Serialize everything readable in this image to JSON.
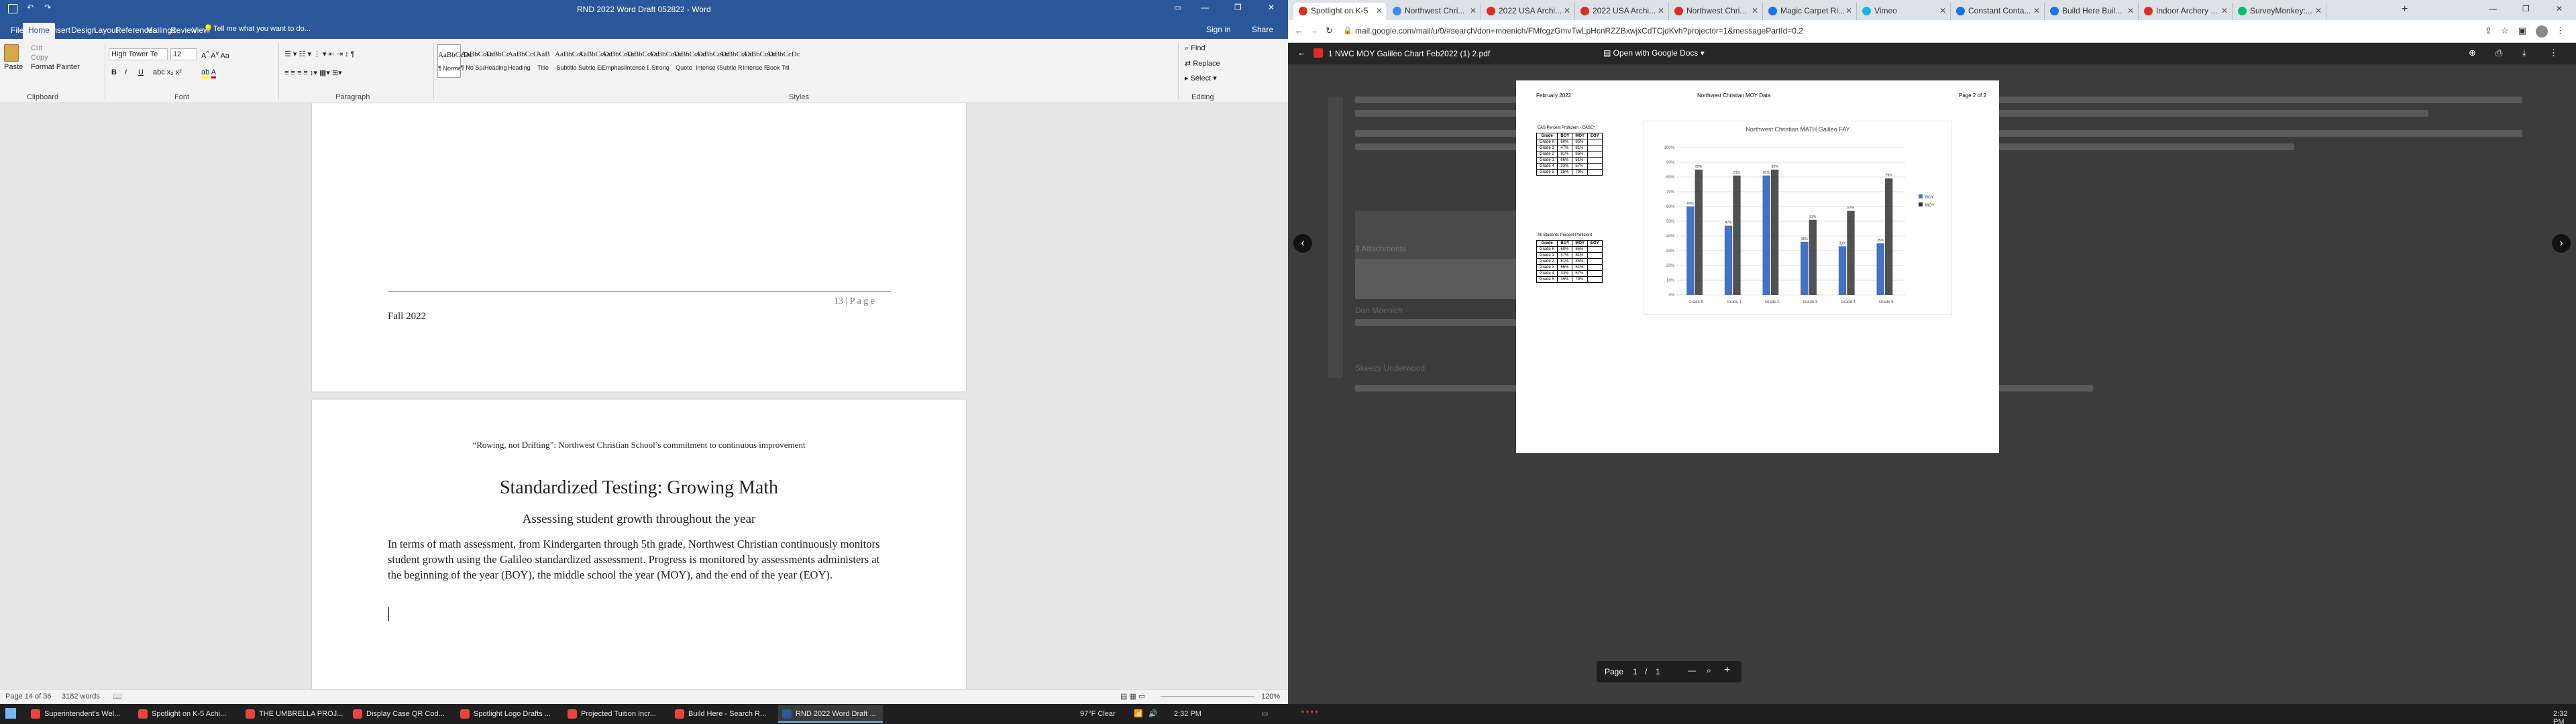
{
  "word": {
    "title": "RND 2022 Word Draft 052822  -  Word",
    "sign_in": "Sign in",
    "share": "Share",
    "tell_me": "Tell me what you want to do...",
    "tabs": [
      "File",
      "Home",
      "Insert",
      "Design",
      "Layout",
      "References",
      "Mailings",
      "Review",
      "View"
    ],
    "clipboard": {
      "paste": "Paste",
      "cut": "Cut",
      "copy": "Copy",
      "format_painter": "Format Painter",
      "label": "Clipboard"
    },
    "font": {
      "name": "High Tower Te",
      "size": "12",
      "label": "Font"
    },
    "paragraph_label": "Paragraph",
    "styles": [
      {
        "sample": "AaBbCcDc",
        "name": "¶ Normal"
      },
      {
        "sample": "AaBbCcDc",
        "name": "¶ No Spac..."
      },
      {
        "sample": "AaBbCc",
        "name": "Heading 1"
      },
      {
        "sample": "AaBbCcC",
        "name": "Heading 2"
      },
      {
        "sample": "AaB",
        "name": "Title"
      },
      {
        "sample": "AaBbCcC",
        "name": "Subtitle"
      },
      {
        "sample": "AaBbCcDc",
        "name": "Subtle Em..."
      },
      {
        "sample": "AaBbCcDc",
        "name": "Emphasis"
      },
      {
        "sample": "AaBbCcDc",
        "name": "Intense E..."
      },
      {
        "sample": "AaBbCcDc",
        "name": "Strong"
      },
      {
        "sample": "AaBbCcDc",
        "name": "Quote"
      },
      {
        "sample": "AaBbCcDc",
        "name": "Intense Q..."
      },
      {
        "sample": "AaBbCcDc",
        "name": "Subtle Ref..."
      },
      {
        "sample": "AaBbCcDc",
        "name": "Intense Re..."
      },
      {
        "sample": "AaBbCcDc",
        "name": "Book Title"
      }
    ],
    "styles_label": "Styles",
    "editing": {
      "find": "Find",
      "replace": "Replace",
      "select": "Select",
      "label": "Editing"
    },
    "doc": {
      "footer_left": "Fall 2022",
      "footer_right": "13 | P a g e",
      "header": "“Rowing, not Drifting”:  Northwest Christian School’s commitment to continuous improvement",
      "heading": "Standardized Testing:  Growing Math",
      "subheading": "Assessing student growth throughout the year",
      "paragraph": "In terms of math assessment, from Kindergarten through 5th grade, Northwest Christian continuously monitors student growth using the Galileo standardized assessment.  Progress is monitored by assessments administers at the beginning of the year (BOY), the middle school the year (MOY), and the end of the year (EOY)."
    },
    "status": {
      "page": "Page 14 of 36",
      "words": "3182 words",
      "zoom": "120%"
    }
  },
  "chrome": {
    "tabs": [
      {
        "label": "Spotlight on K-5",
        "color": "#d93025"
      },
      {
        "label": "Northwest Chri...",
        "color": "#4285f4"
      },
      {
        "label": "2022 USA Archi...",
        "color": "#d93025"
      },
      {
        "label": "2022 USA Archi...",
        "color": "#d93025"
      },
      {
        "label": "Northwest Chri...",
        "color": "#d93025"
      },
      {
        "label": "Magic Carpet Ri...",
        "color": "#1a73e8"
      },
      {
        "label": "Vimeo",
        "color": "#1ab7ea"
      },
      {
        "label": "Constant Conta...",
        "color": "#1a73e8"
      },
      {
        "label": "Build Here Buil...",
        "color": "#1a73e8"
      },
      {
        "label": "Indoor Archery ...",
        "color": "#d93025"
      },
      {
        "label": "SurveyMonkey:...",
        "color": "#00bf6f"
      }
    ],
    "url": "mail.google.com/mail/u/0/#search/don+moenich/FMfcgzGmvTwLpHcnRZZBxwjxCdTCjdKvh?projector=1&messagePartId=0.2",
    "viewer": {
      "filename": "1 NWC MOY Galileo Chart Feb2022 (1) 2.pdf",
      "open_with": "Open with Google Docs"
    },
    "pdf": {
      "date": "February 2022",
      "title": "Northwest Christian MOY Data",
      "page": "Page 2 of 2",
      "table1_title": "EAS Percent Proficient - CASE*",
      "table2_title": "All Students Percent Proficient",
      "chart_title": "Northwest Christian MATH Galileo FAY",
      "cols": [
        "Grade",
        "BOY",
        "MOY",
        "EOY"
      ],
      "rows": [
        [
          "Grade K",
          "60%",
          "85%"
        ],
        [
          "Grade 1",
          "47%",
          "81%"
        ],
        [
          "Grade 2",
          "81%",
          "85%"
        ],
        [
          "Grade 3",
          "66%",
          "51%"
        ],
        [
          "Grade 4",
          "33%",
          "57%"
        ],
        [
          "Grade 5",
          "35%",
          "79%"
        ]
      ]
    },
    "pdf_controls": {
      "page_label": "Page",
      "page": "1",
      "sep": "/",
      "total": "1"
    },
    "email": {
      "attachments": "3 Attachments",
      "sender": "Don Moenich",
      "sender2": "Skeezy Underwood"
    }
  },
  "taskbar": {
    "items": [
      {
        "label": "Superintendent's Wel...",
        "color": "#e8453c"
      },
      {
        "label": "Spotlight on K-5 Achi...",
        "color": "#e8453c"
      },
      {
        "label": "THE UMBRELLA PROJ...",
        "color": "#e8453c"
      },
      {
        "label": "Display Case QR Cod...",
        "color": "#e8453c"
      },
      {
        "label": "Spotlight Logo Drafts ...",
        "color": "#e8453c"
      },
      {
        "label": "Projected Tuition Incr...",
        "color": "#e8453c"
      },
      {
        "label": "Build Here - Search R...",
        "color": "#e8453c"
      },
      {
        "label": "RND 2022 Word Draft ...",
        "color": "#2b579a"
      }
    ],
    "weather": "97°F  Clear",
    "time": "2:32 PM",
    "time2": "2:32 PM"
  },
  "chart_data": {
    "type": "bar",
    "title": "Northwest Christian MATH Galileo FAY",
    "categories": [
      "Grade K",
      "Grade 1",
      "Grade 2",
      "Grade 3",
      "Grade 4",
      "Grade 5"
    ],
    "series": [
      {
        "name": "BOY",
        "values": [
          60,
          47,
          81,
          36,
          33,
          35
        ],
        "color": "#4472c4"
      },
      {
        "name": "MOY",
        "values": [
          85,
          81,
          85,
          51,
          57,
          79
        ],
        "color": "#333333"
      }
    ],
    "ylim": [
      0,
      100
    ]
  }
}
